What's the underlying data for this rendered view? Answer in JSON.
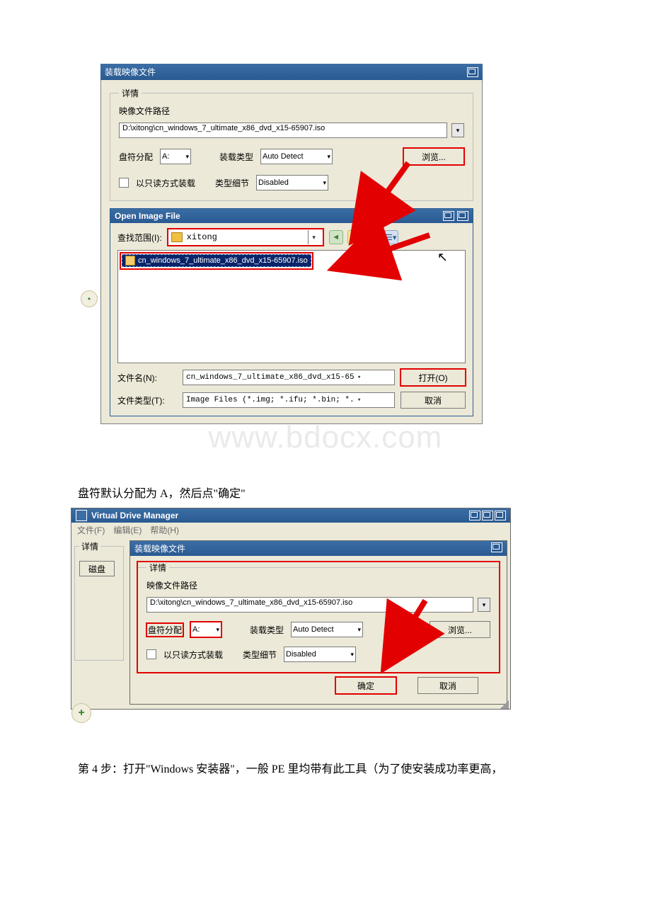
{
  "screenshot1": {
    "title": "装载映像文件",
    "details_legend": "详情",
    "path_label": "映像文件路径",
    "path_value": "D:\\xitong\\cn_windows_7_ultimate_x86_dvd_x15-65907.iso",
    "drive_label": "盘符分配",
    "drive_value": "A:",
    "mount_type_label": "装载类型",
    "mount_type_value": "Auto Detect",
    "browse_label": "浏览...",
    "readonly_label": "以只读方式装载",
    "type_detail_label": "类型细节",
    "type_detail_value": "Disabled",
    "openfile": {
      "title": "Open Image File",
      "lookin_label": "查找范围(I):",
      "lookin_value": "xitong",
      "file_item": "cn_windows_7_ultimate_x86_dvd_x15-65907.iso",
      "filename_label": "文件名(N):",
      "filename_value": "cn_windows_7_ultimate_x86_dvd_x15-65",
      "filetype_label": "文件类型(T):",
      "filetype_value": "Image Files (*.img; *.ifu; *.bin; *.",
      "open_btn": "打开(O)",
      "cancel_btn": "取消"
    }
  },
  "watermark": "www.bdocx.com",
  "caption1": "盘符默认分配为 A，然后点\"确定\"",
  "screenshot2": {
    "outer_title": "Virtual Drive Manager",
    "menu_file": "文件(F)",
    "menu_edit": "编辑(E)",
    "menu_help": "帮助(H)",
    "left_details_legend": "详情",
    "disk_btn": "磁盘",
    "inner_title": "装载映像文件",
    "details_legend": "详情",
    "path_label": "映像文件路径",
    "path_value": "D:\\xitong\\cn_windows_7_ultimate_x86_dvd_x15-65907.iso",
    "drive_label": "盘符分配",
    "drive_value": "A:",
    "mount_type_label": "装载类型",
    "mount_type_value": "Auto Detect",
    "browse_label": "浏览...",
    "readonly_label": "以只读方式装载",
    "type_detail_label": "类型细节",
    "type_detail_value": "Disabled",
    "ok_btn": "确定",
    "cancel_btn": "取消"
  },
  "caption2": "第 4 步：打开\"Windows 安装器\"，一般 PE 里均带有此工具（为了使安装成功率更高，"
}
